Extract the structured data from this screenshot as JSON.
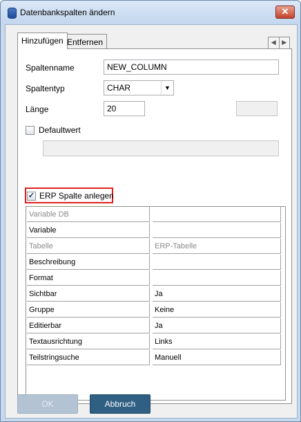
{
  "window": {
    "title": "Datenbankspalten ändern",
    "close_glyph": "✕"
  },
  "tabs": [
    {
      "label": "Hinzufügen",
      "active": true
    },
    {
      "label": "Entfernen",
      "active": false
    }
  ],
  "tab_scroll": {
    "left": "◀",
    "right": "▶"
  },
  "form": {
    "spaltenname_label": "Spaltenname",
    "spaltenname_value": "NEW_COLUMN",
    "spaltentyp_label": "Spaltentyp",
    "spaltentyp_value": "CHAR",
    "laenge_label": "Länge",
    "laenge_value": "20",
    "defaultwert_label": "Defaultwert",
    "defaultwert_checked": false,
    "erp_label": "ERP Spalte anlegen",
    "erp_checked": true,
    "checkmark": "✓",
    "combo_arrow": "▼"
  },
  "grid": {
    "rows": [
      {
        "name": "Variable DB",
        "value": "",
        "greyed": true
      },
      {
        "name": "Variable",
        "value": "",
        "greyed": false
      },
      {
        "name": "Tabelle",
        "value": "ERP-Tabelle",
        "greyed": true
      },
      {
        "name": "Beschreibung",
        "value": "",
        "greyed": false
      },
      {
        "name": "Format",
        "value": "",
        "greyed": false
      },
      {
        "name": "Sichtbar",
        "value": "Ja",
        "greyed": false
      },
      {
        "name": "Gruppe",
        "value": "Keine",
        "greyed": false
      },
      {
        "name": "Editierbar",
        "value": "Ja",
        "greyed": false
      },
      {
        "name": "Textausrichtung",
        "value": "Links",
        "greyed": false
      },
      {
        "name": "Teilstringsuche",
        "value": "Manuell",
        "greyed": false
      }
    ]
  },
  "buttons": {
    "ok": "OK",
    "cancel": "Abbruch"
  },
  "colors": {
    "highlight": "#e02020",
    "cancel_button": "#2f5f82",
    "ok_disabled": "#b3c3d3"
  }
}
